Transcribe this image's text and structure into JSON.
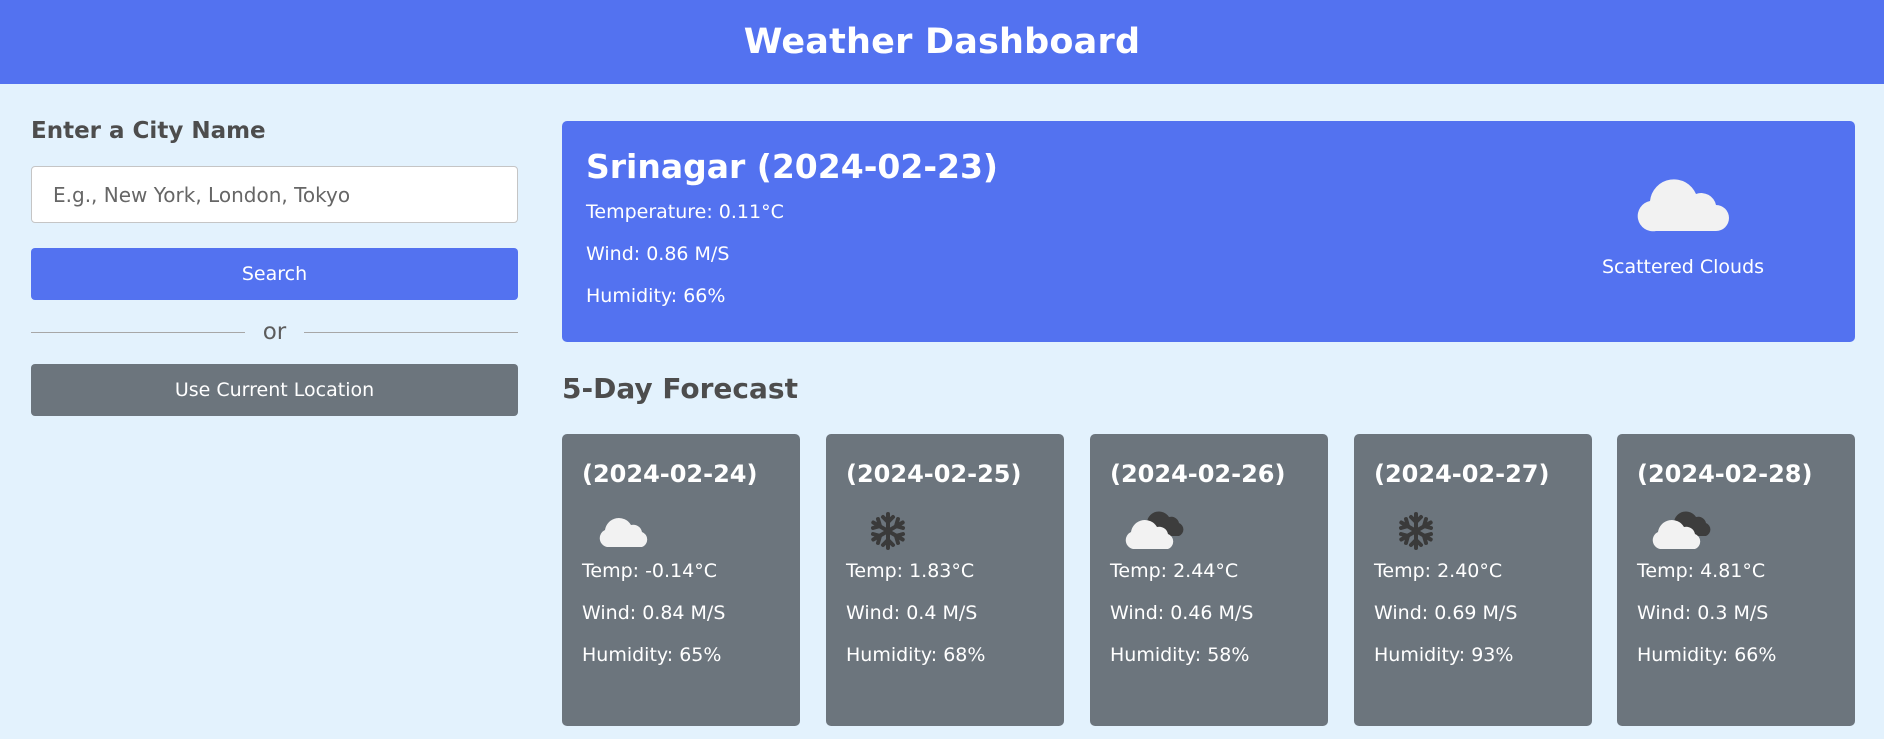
{
  "app": {
    "title": "Weather Dashboard"
  },
  "sidebar": {
    "label": "Enter a City Name",
    "input_placeholder": "E.g., New York, London, Tokyo",
    "search_label": "Search",
    "separator_text": "or",
    "location_label": "Use Current Location"
  },
  "current": {
    "title": "Srinagar (2024-02-23)",
    "temperature": "Temperature: 0.11°C",
    "wind": "Wind: 0.86 M/S",
    "humidity": "Humidity: 66%",
    "description": "Scattered Clouds",
    "icon": "cloud-icon"
  },
  "forecast": {
    "title": "5-Day Forecast",
    "days": [
      {
        "date": "(2024-02-24)",
        "icon": "cloud-icon",
        "temp": "Temp: -0.14°C",
        "wind": "Wind: 0.84 M/S",
        "humidity": "Humidity: 65%"
      },
      {
        "date": "(2024-02-25)",
        "icon": "snowflake-icon",
        "temp": "Temp: 1.83°C",
        "wind": "Wind: 0.4 M/S",
        "humidity": "Humidity: 68%"
      },
      {
        "date": "(2024-02-26)",
        "icon": "broken-clouds-icon",
        "temp": "Temp: 2.44°C",
        "wind": "Wind: 0.46 M/S",
        "humidity": "Humidity: 58%"
      },
      {
        "date": "(2024-02-27)",
        "icon": "snowflake-icon",
        "temp": "Temp: 2.40°C",
        "wind": "Wind: 0.69 M/S",
        "humidity": "Humidity: 93%"
      },
      {
        "date": "(2024-02-28)",
        "icon": "broken-clouds-icon",
        "temp": "Temp: 4.81°C",
        "wind": "Wind: 0.3 M/S",
        "humidity": "Humidity: 66%"
      }
    ]
  },
  "colors": {
    "primary": "#5372f0",
    "secondary": "#6c757d",
    "background": "#e3f2fd"
  }
}
